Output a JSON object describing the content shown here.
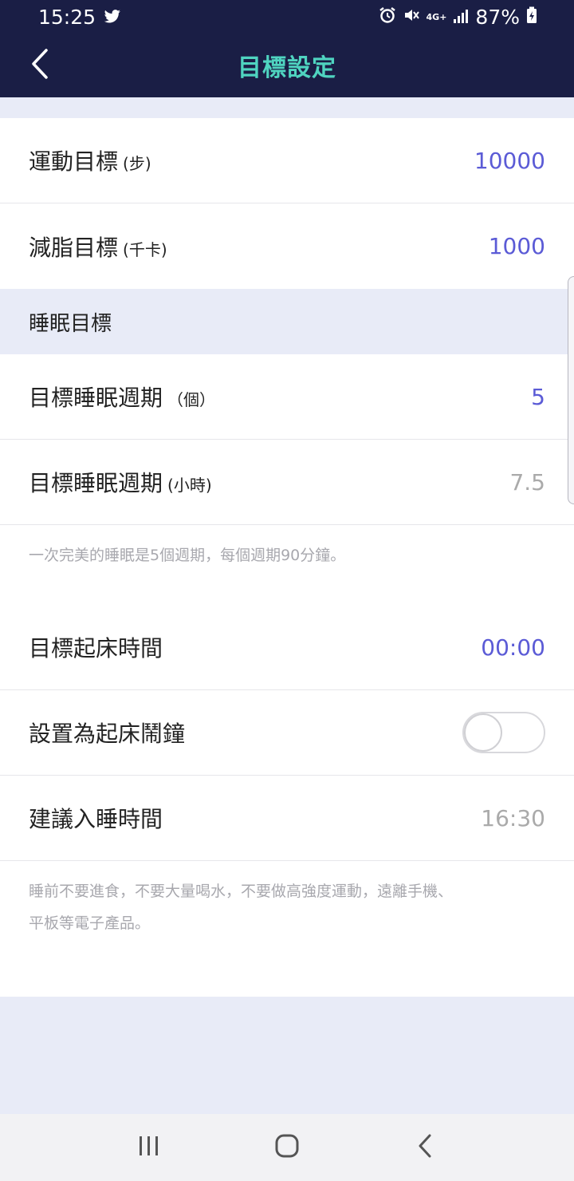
{
  "status_bar": {
    "time": "15:25",
    "battery": "87%",
    "network": "4G+",
    "icons": [
      "twitter-icon",
      "alarm-icon",
      "mute-icon",
      "signal-icon",
      "battery-charging-icon"
    ]
  },
  "header": {
    "title": "目標設定",
    "back_icon": "chevron-left-icon"
  },
  "settings": {
    "exercise_goal": {
      "label": "運動目標",
      "unit": "(步)",
      "value": "10000"
    },
    "fat_loss_goal": {
      "label": "減脂目標",
      "unit": "(千卡)",
      "value": "1000"
    }
  },
  "sleep_section": {
    "title": "睡眠目標",
    "cycles": {
      "label": "目標睡眠週期",
      "unit": "（個）",
      "value": "5"
    },
    "hours": {
      "label": "目標睡眠週期",
      "unit": "(小時)",
      "value": "7.5"
    },
    "note": "一次完美的睡眠是5個週期，每個週期90分鐘。",
    "wake_time": {
      "label": "目標起床時間",
      "value": "00:00"
    },
    "alarm": {
      "label": "設置為起床鬧鐘",
      "enabled": false
    },
    "bedtime": {
      "label": "建議入睡時間",
      "value": "16:30"
    },
    "tip_line1": "睡前不要進食，不要大量喝水，不要做高強度運動，遠離手機、",
    "tip_line2": "平板等電子產品。"
  },
  "colors": {
    "header_bg": "#1a1e45",
    "title_accent": "#4fd4c0",
    "value_accent": "#5b5bd6",
    "muted_value": "#aaaaaa",
    "page_bg": "#e8ebf7"
  },
  "nav_bar": {
    "icons": [
      "recent-apps-icon",
      "home-icon",
      "back-nav-icon"
    ]
  }
}
